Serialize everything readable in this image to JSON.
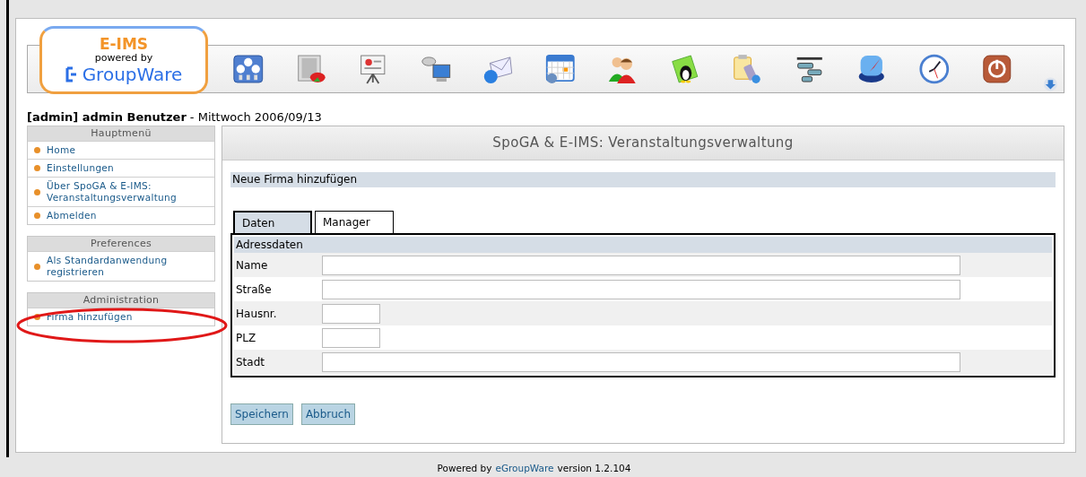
{
  "logo": {
    "title": "E-IMS",
    "subtitle": "powered by",
    "brand": "GroupWare"
  },
  "toolbar": [
    {
      "kind": "dials"
    },
    {
      "kind": "chart"
    },
    {
      "kind": "presentation"
    },
    {
      "kind": "satellite"
    },
    {
      "kind": "mail"
    },
    {
      "kind": "calendar"
    },
    {
      "kind": "people"
    },
    {
      "kind": "folder"
    },
    {
      "kind": "clipboard"
    },
    {
      "kind": "gantt"
    },
    {
      "kind": "compass"
    },
    {
      "kind": "clock"
    },
    {
      "kind": "power"
    },
    {
      "kind": "more"
    }
  ],
  "user_line": {
    "user": "[admin] admin Benutzer",
    "date": "- Mittwoch 2006/09/13"
  },
  "sidebar": [
    {
      "title": "Hauptmenü",
      "highlighted": false,
      "items": [
        {
          "label": "Home"
        },
        {
          "label": "Einstellungen"
        },
        {
          "label": "Über SpoGA & E-IMS: Veranstaltungsverwaltung"
        },
        {
          "label": "Abmelden"
        }
      ]
    },
    {
      "title": "Preferences",
      "highlighted": false,
      "items": [
        {
          "label": "Als Standardanwendung registrieren"
        }
      ]
    },
    {
      "title": "Administration",
      "highlighted": true,
      "items": [
        {
          "label": "Firma hinzufügen"
        }
      ]
    }
  ],
  "main": {
    "title": "SpoGA & E-IMS: Veranstaltungsverwaltung",
    "section_title": "Neue Firma hinzufügen",
    "tabs": [
      {
        "label": "Daten",
        "selected": true
      },
      {
        "label": "Manager",
        "selected": false
      }
    ],
    "legend": "Adressdaten",
    "fields": [
      {
        "label": "Name",
        "kind": "wide"
      },
      {
        "label": "Straße",
        "kind": "wide"
      },
      {
        "label": "Hausnr.",
        "kind": "short"
      },
      {
        "label": "PLZ",
        "kind": "short"
      },
      {
        "label": "Stadt",
        "kind": "wide"
      }
    ],
    "buttons": [
      "Speichern",
      "Abbruch"
    ]
  },
  "footer": {
    "prefix": "Powered by",
    "link": "eGroupWare",
    "suffix": "version 1.2.104"
  }
}
